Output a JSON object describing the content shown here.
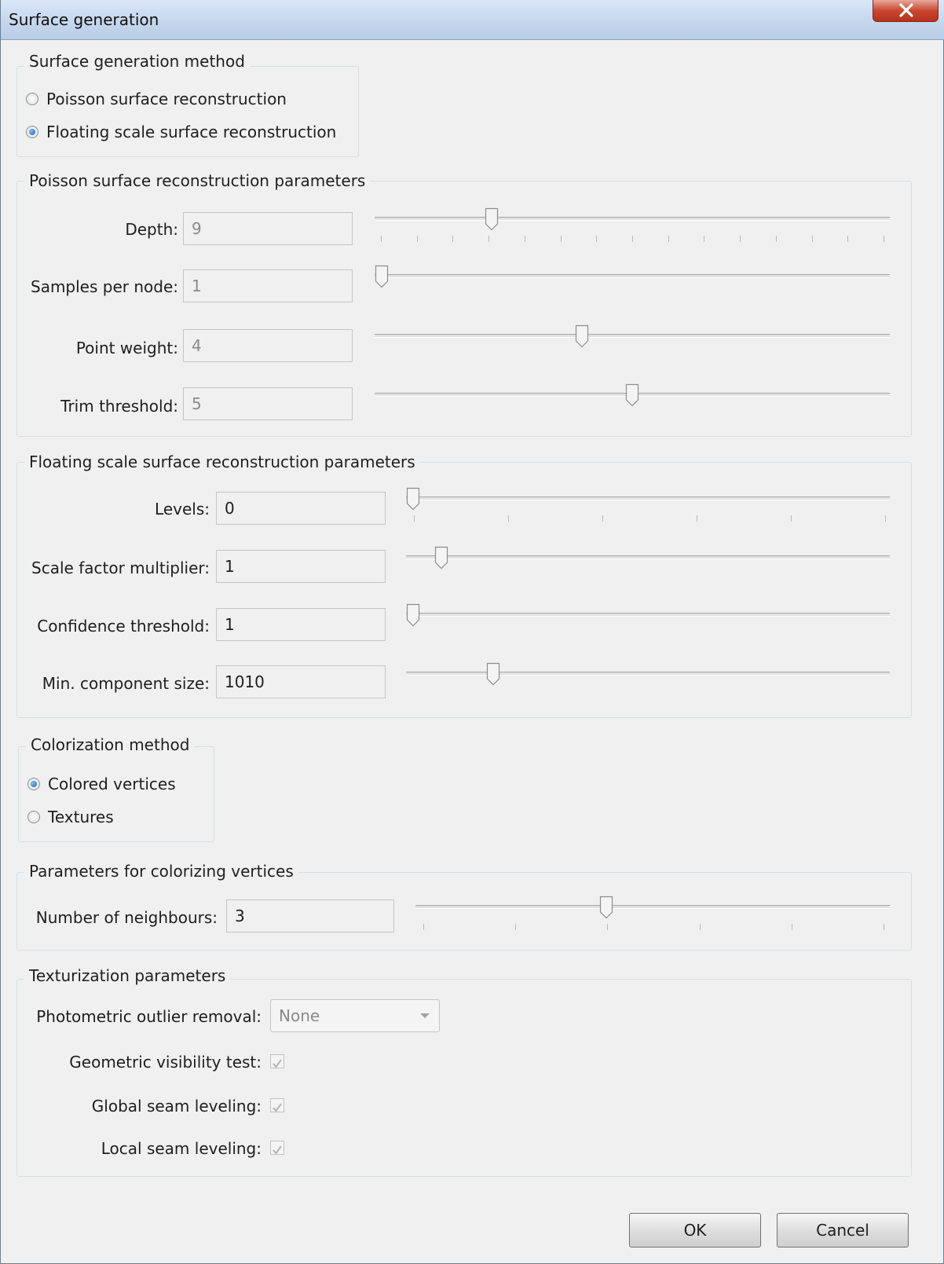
{
  "window": {
    "title": "Surface generation"
  },
  "method_group": {
    "legend": "Surface generation method",
    "options": [
      {
        "label": "Poisson surface reconstruction",
        "selected": false
      },
      {
        "label": "Floating scale surface reconstruction",
        "selected": true
      }
    ]
  },
  "poisson_group": {
    "legend": "Poisson surface reconstruction parameters",
    "params": [
      {
        "label": "Depth:",
        "value": "9",
        "level": 0.22
      },
      {
        "label": "Samples per node:",
        "value": "1",
        "level": 0.0
      },
      {
        "label": "Point weight:",
        "value": "4",
        "level": 0.4
      },
      {
        "label": "Trim threshold:",
        "value": "5",
        "level": 0.5
      }
    ]
  },
  "fssr_group": {
    "legend": "Floating scale surface reconstruction parameters",
    "params": [
      {
        "label": "Levels:",
        "value": "0",
        "level": 0.0
      },
      {
        "label": "Scale factor multiplier:",
        "value": "1",
        "level": 0.06
      },
      {
        "label": "Confidence threshold:",
        "value": "1",
        "level": 0.0
      },
      {
        "label": "Min. component size:",
        "value": "1010",
        "level": 0.17
      }
    ]
  },
  "color_group": {
    "legend": "Colorization method",
    "options": [
      {
        "label": "Colored vertices",
        "selected": true
      },
      {
        "label": "Textures",
        "selected": false
      }
    ]
  },
  "vertices_group": {
    "legend": "Parameters for colorizing vertices",
    "params": [
      {
        "label": "Number of neighbours:",
        "value": "3",
        "level": 0.4
      }
    ]
  },
  "texture_group": {
    "legend": "Texturization parameters",
    "outlier_label": "Photometric outlier removal:",
    "outlier_value": "None",
    "checks": [
      {
        "label": "Geometric visibility test:",
        "checked": true
      },
      {
        "label": "Global seam leveling:",
        "checked": true
      },
      {
        "label": "Local seam leveling:",
        "checked": true
      }
    ]
  },
  "buttons": {
    "ok": "OK",
    "cancel": "Cancel"
  }
}
